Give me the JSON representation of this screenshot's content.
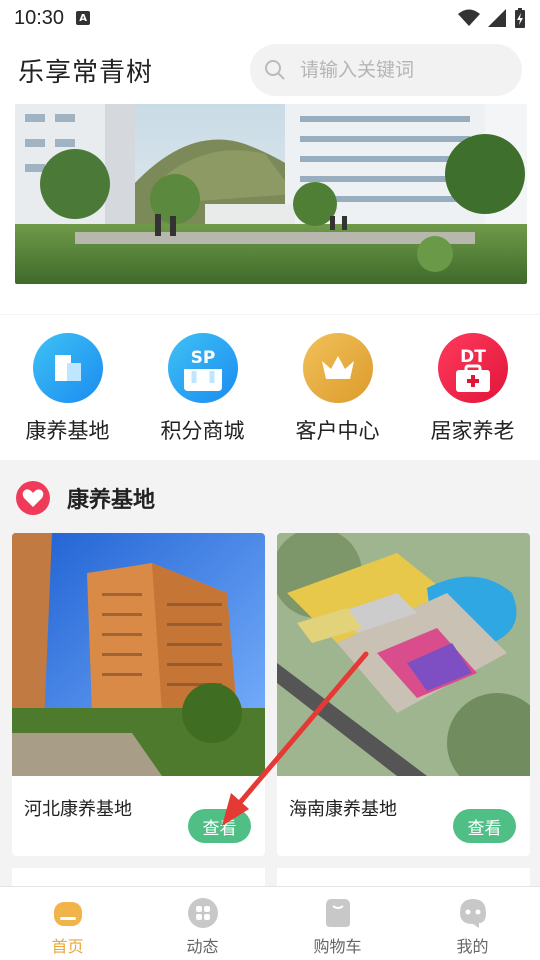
{
  "status_bar": {
    "time": "10:30"
  },
  "header": {
    "title": "乐享常青树",
    "search_placeholder": "请输入关键词"
  },
  "quick_menu": [
    {
      "label": "康养基地",
      "icon": "building-icon"
    },
    {
      "label": "积分商城",
      "icon": "sp-store-icon",
      "badge": "SP"
    },
    {
      "label": "客户中心",
      "icon": "crown-icon"
    },
    {
      "label": "居家养老",
      "icon": "dt-medkit-icon",
      "badge": "DT"
    }
  ],
  "section": {
    "title": "康养基地",
    "icon": "heart-icon"
  },
  "cards": [
    {
      "name": "河北康养基地",
      "button": "查看"
    },
    {
      "name": "海南康养基地",
      "button": "查看"
    }
  ],
  "tabs": [
    {
      "label": "首页",
      "icon": "home-icon",
      "active": true
    },
    {
      "label": "动态",
      "icon": "grid-icon",
      "active": false
    },
    {
      "label": "购物车",
      "icon": "bag-icon",
      "active": false
    },
    {
      "label": "我的",
      "icon": "ghost-icon",
      "active": false
    }
  ],
  "colors": {
    "accent": "#e8a93a",
    "button": "#4fbf86",
    "arrow": "#e53935"
  }
}
